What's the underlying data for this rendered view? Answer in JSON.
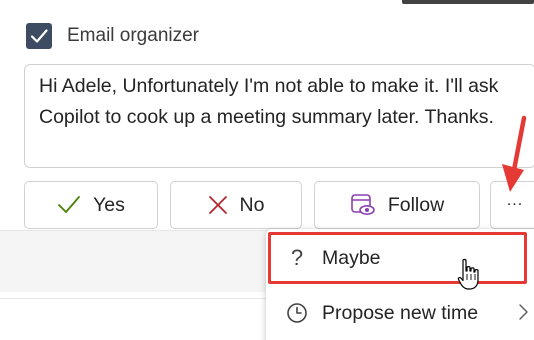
{
  "checkbox": {
    "label": "Email organizer",
    "checked": true
  },
  "message": {
    "text": "Hi Adele, Unfortunately I'm not able to make it. I'll ask Copilot to cook up a meeting summary later. Thanks."
  },
  "buttons": {
    "yes": "Yes",
    "no": "No",
    "follow": "Follow",
    "more": "..."
  },
  "menu": {
    "maybe": "Maybe",
    "propose": "Propose new time"
  },
  "icons": {
    "yes": "checkmark-icon",
    "no": "x-icon",
    "follow": "calendar-eye-icon",
    "maybe": "question-mark-icon",
    "propose": "clock-icon",
    "submenu": "chevron-right-icon"
  },
  "colors": {
    "annotation_red": "#e53935",
    "yes_green": "#498205",
    "no_red": "#b4262f",
    "follow_purple": "#8c3fb3",
    "checkbox_fill": "#3d4b63"
  }
}
